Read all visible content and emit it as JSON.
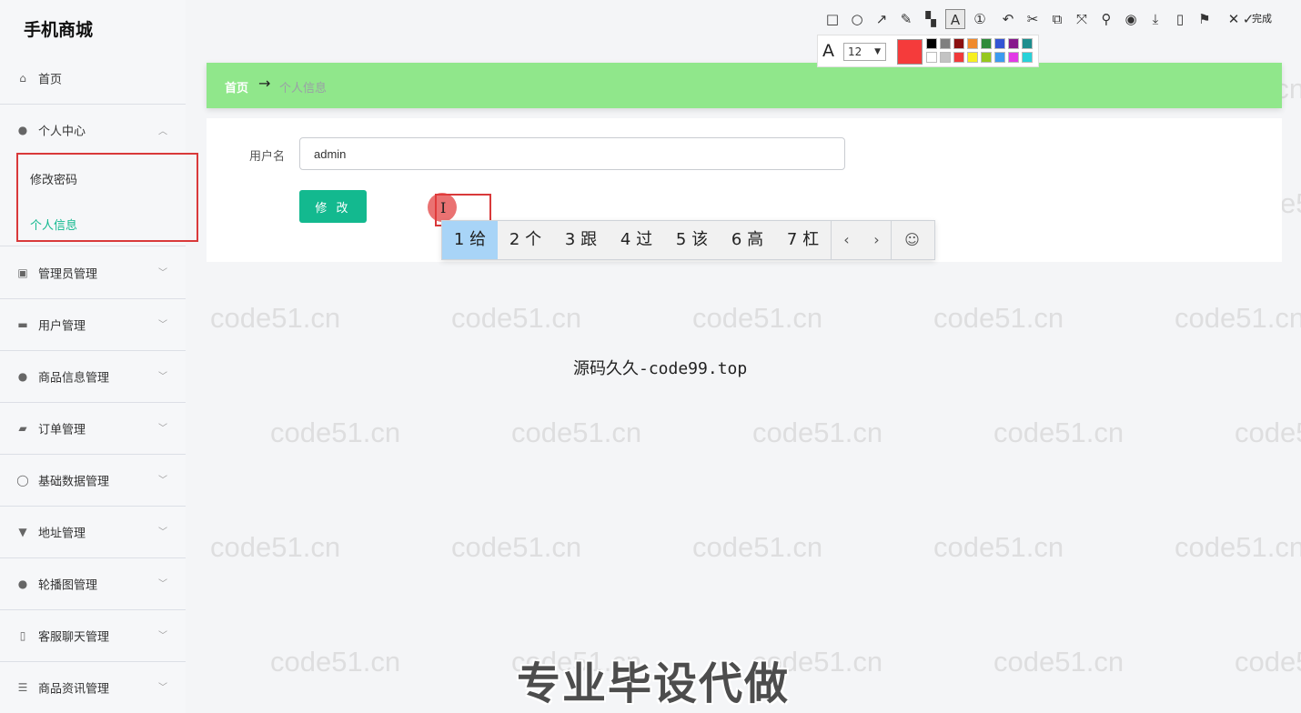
{
  "app": {
    "title": "手机商城"
  },
  "sidebar": {
    "home": "首页",
    "personal_center": {
      "label": "个人中心",
      "sub_items": [
        "修改密码",
        "个人信息"
      ]
    },
    "items": [
      "管理员管理",
      "用户管理",
      "商品信息管理",
      "订单管理",
      "基础数据管理",
      "地址管理",
      "轮播图管理",
      "客服聊天管理",
      "商品资讯管理"
    ]
  },
  "breadcrumb": {
    "home": "首页",
    "separator": "→",
    "current": "个人信息"
  },
  "form": {
    "username_label": "用户名",
    "username_value": "admin",
    "submit_label": "修 改"
  },
  "ime": {
    "candidates": [
      "1 给",
      "2 个",
      "3 跟",
      "4 过",
      "5 该",
      "6 高",
      "7 杠"
    ],
    "prev": "‹",
    "next": "›",
    "emoji": "☺"
  },
  "toolbar": {
    "done_label": "完成",
    "font_size": "12",
    "current_color": "#f53b3b",
    "palette": [
      "#000000",
      "#7f7f7f",
      "#8b1010",
      "#f08a2c",
      "#2f8a3a",
      "#3455d4",
      "#871a8c",
      "#1d8e8e",
      "#ffffff",
      "#c3c3c3",
      "#f03a3a",
      "#f7ef1f",
      "#96c81e",
      "#3c9bf0",
      "#e23ae6",
      "#27d2d9"
    ]
  },
  "watermark": "code51.cn",
  "overlay": {
    "source": "源码久久-code99.top",
    "promo": "专业毕设代做"
  },
  "colors": {
    "breadcrumb_bg": "#90e78b",
    "primary_button": "#13b98f",
    "active_submenu": "#13b98f",
    "highlight_border": "#d9393a"
  }
}
